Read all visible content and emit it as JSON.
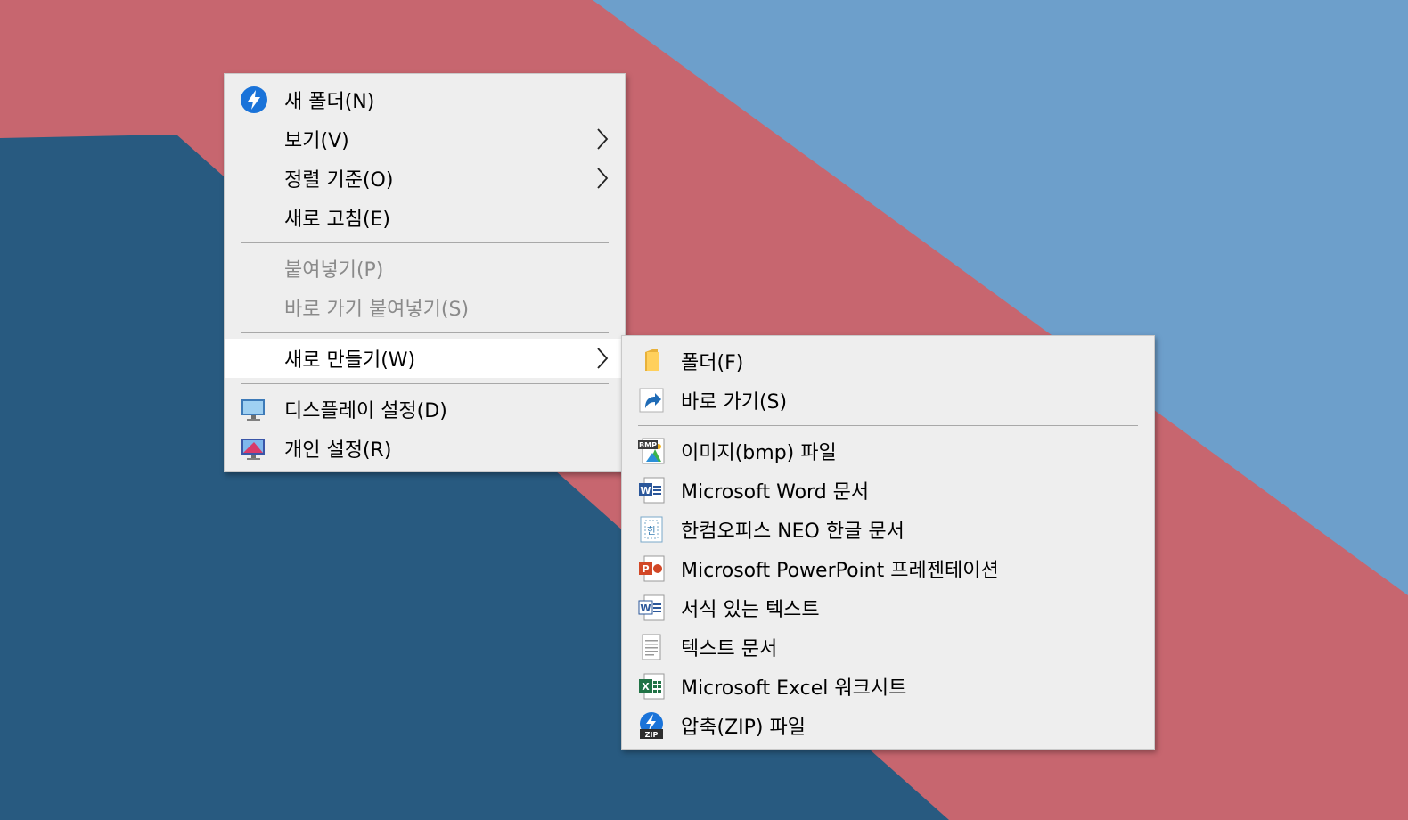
{
  "colors": {
    "wallpaper_light_blue": "#6d9fcb",
    "wallpaper_red": "#c7666f",
    "wallpaper_dark_blue": "#285a80",
    "menu_background": "#eeeeee",
    "highlight": "#ffffff",
    "disabled_text": "#8a8a8a"
  },
  "context_menu": {
    "new_folder": {
      "label": "새 폴더(N)",
      "icon": "lightning-circle-icon"
    },
    "view": {
      "label": "보기(V)"
    },
    "sort_by": {
      "label": "정렬 기준(O)"
    },
    "refresh": {
      "label": "새로 고침(E)"
    },
    "paste": {
      "label": "붙여넣기(P)",
      "disabled": true
    },
    "paste_shortcut": {
      "label": "바로 가기 붙여넣기(S)",
      "disabled": true
    },
    "new": {
      "label": "새로 만들기(W)",
      "highlighted": true
    },
    "display_settings": {
      "label": "디스플레이 설정(D)",
      "icon": "monitor-icon"
    },
    "personalize": {
      "label": "개인 설정(R)",
      "icon": "personalize-monitor-icon"
    }
  },
  "new_submenu": {
    "folder": {
      "label": "폴더(F)",
      "icon": "folder-icon"
    },
    "shortcut": {
      "label": "바로 가기(S)",
      "icon": "shortcut-icon"
    },
    "bmp_image": {
      "label": "이미지(bmp) 파일",
      "icon": "bmp-image-icon",
      "icon_text": "BMP"
    },
    "word_document": {
      "label": "Microsoft Word 문서",
      "icon": "word-document-icon",
      "icon_text": "W"
    },
    "hwp_document": {
      "label": "한컴오피스 NEO 한글 문서",
      "icon": "hwp-document-icon",
      "icon_text": "한"
    },
    "powerpoint": {
      "label": "Microsoft PowerPoint 프레젠테이션",
      "icon": "powerpoint-icon",
      "icon_text": "P"
    },
    "rich_text": {
      "label": "서식 있는 텍스트",
      "icon": "rich-text-icon",
      "icon_text": "W"
    },
    "text_document": {
      "label": "텍스트 문서",
      "icon": "text-document-icon"
    },
    "excel": {
      "label": "Microsoft Excel 워크시트",
      "icon": "excel-worksheet-icon",
      "icon_text": "X"
    },
    "zip": {
      "label": "압축(ZIP) 파일",
      "icon": "zip-archive-icon",
      "icon_text": "ZIP"
    }
  }
}
